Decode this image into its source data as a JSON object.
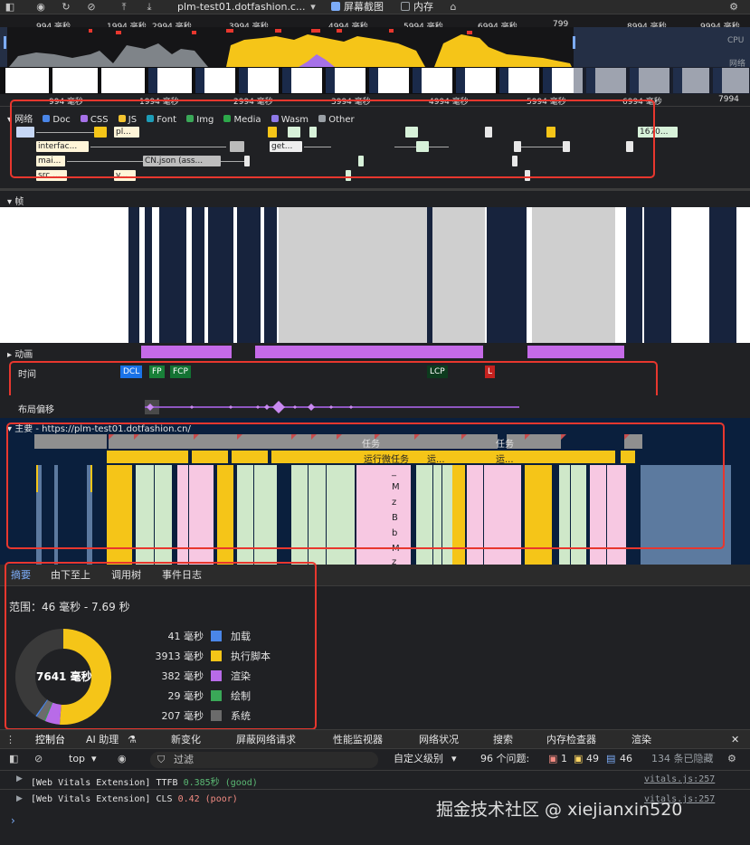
{
  "toolbar": {
    "url_select": "plm-test01.dotfashion.c...",
    "screenshot_label": "屏幕截图",
    "screenshot_checked": true,
    "memory_label": "内存",
    "memory_checked": false,
    "icons": [
      "sidebar-icon",
      "record-icon",
      "reload-icon",
      "clear-icon",
      "upload-icon",
      "download-icon",
      "dropdown-icon",
      "broom-icon",
      "settings-icon"
    ]
  },
  "overview": {
    "ticks": [
      "994 毫秒",
      "1994 毫秒",
      "2994 毫秒",
      "3994 毫秒",
      "4994 毫秒",
      "5994 毫秒",
      "6994 毫秒",
      "799",
      "8994 毫秒",
      "9994 毫秒"
    ],
    "cpu_label": "CPU",
    "net_label": "网络",
    "ruler": [
      "994 毫秒",
      "1994 毫秒",
      "2994 毫秒",
      "3994 毫秒",
      "4994 毫秒",
      "5994 毫秒",
      "6994 毫秒",
      "7994"
    ]
  },
  "network": {
    "title": "网络",
    "legend": [
      {
        "label": "Doc",
        "color": "#4a86e8"
      },
      {
        "label": "CSS",
        "color": "#a671e8"
      },
      {
        "label": "JS",
        "color": "#f4c430"
      },
      {
        "label": "Font",
        "color": "#1d9db8"
      },
      {
        "label": "Img",
        "color": "#3aa858"
      },
      {
        "label": "Media",
        "color": "#2da84a"
      },
      {
        "label": "Wasm",
        "color": "#8e79e8"
      },
      {
        "label": "Other",
        "color": "#9aa0a6"
      }
    ],
    "bars": [
      "pl...",
      "interfac...",
      "get...",
      "mai...",
      "CN.json (ass...",
      "src ...",
      "v...",
      "1670..."
    ]
  },
  "frames": {
    "title": "帧"
  },
  "animation": {
    "title": "动画"
  },
  "timings": {
    "title": "时间",
    "markers": [
      {
        "label": "DCL",
        "color": "#1a73e8"
      },
      {
        "label": "FP",
        "color": "#188038"
      },
      {
        "label": "FCP",
        "color": "#137333"
      },
      {
        "label": "LCP",
        "color": "#0d3b1e"
      },
      {
        "label": "L",
        "color": "#c5221f"
      }
    ]
  },
  "layout_shift": {
    "title": "布局偏移"
  },
  "main": {
    "title": "主要 - https://plm-test01.dotfashion.cn/",
    "task_label": "任务",
    "task_label_2": "任务",
    "microtask_label": "运行微任务",
    "short_labels": [
      "运...",
      "运..."
    ],
    "stack_letters": [
      "_",
      "M",
      "z",
      "B",
      "b",
      "M",
      "z"
    ]
  },
  "bottom_tabs": [
    "摘要",
    "由下至上",
    "调用树",
    "事件日志"
  ],
  "summary": {
    "range": "范围：46 毫秒 - 7.69 秒",
    "total": "7641 毫秒",
    "rows": [
      {
        "value": "41 毫秒",
        "label": "加载",
        "color": "#4a86e8",
        "ms": 41
      },
      {
        "value": "3913 毫秒",
        "label": "执行脚本",
        "color": "#f5c518",
        "ms": 3913
      },
      {
        "value": "382 毫秒",
        "label": "渲染",
        "color": "#b86be8",
        "ms": 382
      },
      {
        "value": "29 毫秒",
        "label": "绘制",
        "color": "#3aa858",
        "ms": 29
      },
      {
        "value": "207 毫秒",
        "label": "系统",
        "color": "#6b6b6b",
        "ms": 207
      }
    ],
    "idle_ms": 3069
  },
  "drawer_tabs": [
    "控制台",
    "AI 助理",
    "新变化",
    "屏蔽网络请求",
    "性能监视器",
    "网络状况",
    "搜索",
    "内存检查器",
    "渲染"
  ],
  "console_toolbar": {
    "context": "top",
    "filter": "过滤",
    "levels": "自定义级别",
    "issues_label": "96 个问题:",
    "errors": "1",
    "warnings": "49",
    "infos": "46",
    "hidden": "134 条已隐藏"
  },
  "console": [
    {
      "prefix": "[Web Vitals Extension] TTFB ",
      "value": "0.385秒 (good)",
      "value_color": "#5bb974",
      "source": "vitals.js:257"
    },
    {
      "prefix": "[Web Vitals Extension] CLS ",
      "value": "0.42 (poor)",
      "value_color": "#f28b82",
      "source": "vitals.js:257"
    }
  ],
  "watermark": "掘金技术社区 @ xiejianxin520"
}
